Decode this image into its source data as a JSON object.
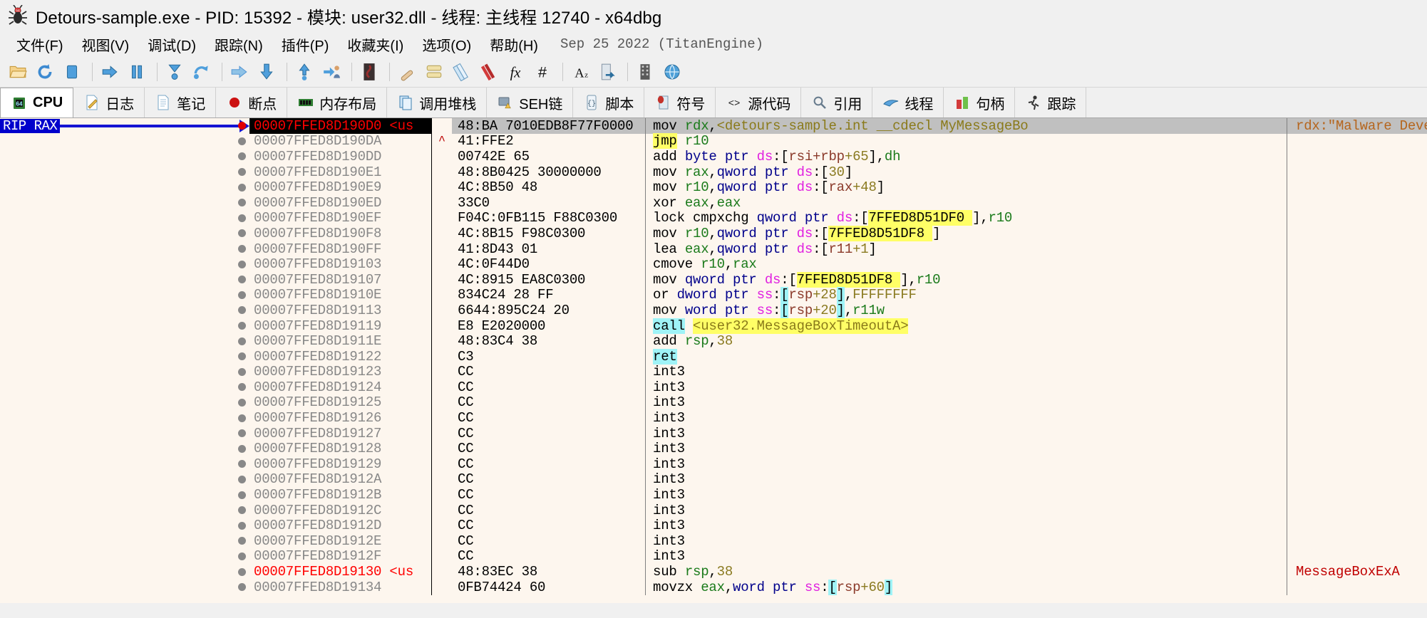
{
  "window": {
    "title": "Detours-sample.exe - PID: 15392 - 模块: user32.dll - 线程: 主线程 12740 - x64dbg",
    "icon": "bug-icon"
  },
  "menubar": {
    "items": [
      {
        "label": "文件(F)"
      },
      {
        "label": "视图(V)"
      },
      {
        "label": "调试(D)"
      },
      {
        "label": "跟踪(N)"
      },
      {
        "label": "插件(P)"
      },
      {
        "label": "收藏夹(I)"
      },
      {
        "label": "选项(O)"
      },
      {
        "label": "帮助(H)"
      }
    ],
    "version": "Sep 25 2022 (TitanEngine)"
  },
  "toolbar": {
    "buttons": [
      {
        "name": "open-icon",
        "title": "打开"
      },
      {
        "name": "restart-icon",
        "title": "重新运行"
      },
      {
        "name": "stop-icon",
        "title": "关闭"
      },
      {
        "sep": true
      },
      {
        "name": "run-icon",
        "title": "运行"
      },
      {
        "name": "pause-icon",
        "title": "暂停"
      },
      {
        "sep": true
      },
      {
        "name": "step-into-icon",
        "title": "单步进入"
      },
      {
        "name": "step-over-icon",
        "title": "单步步过"
      },
      {
        "sep": true
      },
      {
        "name": "trace-into-icon",
        "title": "跟踪进入"
      },
      {
        "name": "trace-over-icon",
        "title": "跟踪步过"
      },
      {
        "sep": true
      },
      {
        "name": "execute-till-return-icon",
        "title": "执行到返回"
      },
      {
        "name": "execute-till-user-code-icon",
        "title": "执行到用户代码"
      },
      {
        "sep": true
      },
      {
        "name": "scylla-icon",
        "title": "Scylla"
      },
      {
        "sep": true
      },
      {
        "name": "patch-icon",
        "title": "补丁"
      },
      {
        "name": "log-icon",
        "title": "日志"
      },
      {
        "name": "notes-icon",
        "title": "笔记"
      },
      {
        "name": "bookmark-icon",
        "title": "书签"
      },
      {
        "name": "function-icon",
        "title": "函数"
      },
      {
        "name": "hash-icon",
        "title": "计算器"
      },
      {
        "sep": true
      },
      {
        "name": "font-icon",
        "title": "字体"
      },
      {
        "name": "export-icon",
        "title": "导出"
      },
      {
        "sep": true
      },
      {
        "name": "memory-map-icon",
        "title": "内存布局"
      },
      {
        "name": "globe-icon",
        "title": "在线"
      }
    ]
  },
  "tabs": [
    {
      "label": "CPU",
      "icon": "cpu-chip-icon",
      "active": true
    },
    {
      "label": "日志",
      "icon": "log-page-icon",
      "active": false
    },
    {
      "label": "笔记",
      "icon": "notes-page-icon",
      "active": false
    },
    {
      "label": "断点",
      "icon": "breakpoint-dot-icon",
      "active": false
    },
    {
      "label": "内存布局",
      "icon": "memory-ram-icon",
      "active": false
    },
    {
      "label": "调用堆栈",
      "icon": "call-stack-icon",
      "active": false
    },
    {
      "label": "SEH链",
      "icon": "seh-warning-icon",
      "active": false
    },
    {
      "label": "脚本",
      "icon": "script-icon",
      "active": false
    },
    {
      "label": "符号",
      "icon": "symbol-book-icon",
      "active": false
    },
    {
      "label": "源代码",
      "icon": "source-code-icon",
      "active": false
    },
    {
      "label": "引用",
      "icon": "magnifier-icon",
      "active": false
    },
    {
      "label": "线程",
      "icon": "threads-icon",
      "active": false
    },
    {
      "label": "句柄",
      "icon": "handles-icon",
      "active": false
    },
    {
      "label": "跟踪",
      "icon": "trace-run-icon",
      "active": false
    }
  ],
  "disassembly": {
    "rip_label": "RIP RAX",
    "rows": [
      {
        "bp": "red",
        "addr": "00007FFED8D190D0",
        "addr_suffix": " <us",
        "arrow": "",
        "bytes": "48:BA 7010EDB8F77F0000",
        "dis_html": "<span class=\"mn\">mov</span> <span class=\"reg\">rdx</span>,<span class=\"sym\">&lt;detours-sample.int __cdecl MyMessageBo</span>",
        "dis_text": "mov rdx,<detours-sample.int __cdecl MyMessageBo",
        "comment": "rdx:\"Malware Development",
        "selected": true
      },
      {
        "bp": "gray",
        "addr": "00007FFED8D190DA",
        "addr_suffix": "",
        "arrow": "^",
        "bytes": "41:FFE2",
        "dis_html": "<span class=\"mn hl-y\">jmp</span> <span class=\"reg\">r10</span>",
        "dis_text": "jmp r10",
        "comment": ""
      },
      {
        "bp": "gray",
        "addr": "00007FFED8D190DD",
        "addr_suffix": "",
        "arrow": "",
        "bytes": "00742E 65",
        "dis_html": "<span class=\"mn\">add</span> <span class=\"kw\">byte ptr</span> <span class=\"seg\">ds</span>:<span class=\"brk\">[</span><span class=\"memreg\">rsi+rbp</span><span class=\"num\">+65</span><span class=\"brk\">]</span>,<span class=\"reg\">dh</span>",
        "dis_text": "add byte ptr ds:[rsi+rbp+65],dh",
        "comment": ""
      },
      {
        "bp": "gray",
        "addr": "00007FFED8D190E1",
        "addr_suffix": "",
        "arrow": "",
        "bytes": "48:8B0425 30000000",
        "dis_html": "<span class=\"mn\">mov</span> <span class=\"reg\">rax</span>,<span class=\"kw\">qword ptr</span> <span class=\"seg\">ds</span>:<span class=\"brk\">[</span><span class=\"num\">30</span><span class=\"brk\">]</span>",
        "dis_text": "mov rax,qword ptr ds:[30]",
        "comment": ""
      },
      {
        "bp": "gray",
        "addr": "00007FFED8D190E9",
        "addr_suffix": "",
        "arrow": "",
        "bytes": "4C:8B50 48",
        "dis_html": "<span class=\"mn\">mov</span> <span class=\"reg\">r10</span>,<span class=\"kw\">qword ptr</span> <span class=\"seg\">ds</span>:<span class=\"brk\">[</span><span class=\"memreg\">rax</span><span class=\"num\">+48</span><span class=\"brk\">]</span>",
        "dis_text": "mov r10,qword ptr ds:[rax+48]",
        "comment": ""
      },
      {
        "bp": "gray",
        "addr": "00007FFED8D190ED",
        "addr_suffix": "",
        "arrow": "",
        "bytes": "33C0",
        "dis_html": "<span class=\"mn\">xor</span> <span class=\"reg\">eax</span>,<span class=\"reg\">eax</span>",
        "dis_text": "xor eax,eax",
        "comment": ""
      },
      {
        "bp": "gray",
        "addr": "00007FFED8D190EF",
        "addr_suffix": "",
        "arrow": "",
        "bytes": "F04C:0FB115 F88C0300",
        "dis_html": "<span class=\"mn\">lock cmpxchg</span> <span class=\"kw\">qword ptr</span> <span class=\"seg\">ds</span>:<span class=\"brk\">[</span><span class=\"hl-y\">7FFED8D51DF0 </span><span class=\"brk\">]</span>,<span class=\"reg\">r10</span>",
        "dis_text": "lock cmpxchg qword ptr ds:[7FFED8D51DF0 ],r10",
        "comment": ""
      },
      {
        "bp": "gray",
        "addr": "00007FFED8D190F8",
        "addr_suffix": "",
        "arrow": "",
        "bytes": "4C:8B15 F98C0300",
        "dis_html": "<span class=\"mn\">mov</span> <span class=\"reg\">r10</span>,<span class=\"kw\">qword ptr</span> <span class=\"seg\">ds</span>:<span class=\"brk\">[</span><span class=\"hl-y\">7FFED8D51DF8 </span><span class=\"brk\">]</span>",
        "dis_text": "mov r10,qword ptr ds:[7FFED8D51DF8 ]",
        "comment": ""
      },
      {
        "bp": "gray",
        "addr": "00007FFED8D190FF",
        "addr_suffix": "",
        "arrow": "",
        "bytes": "41:8D43 01",
        "dis_html": "<span class=\"mn\">lea</span> <span class=\"reg\">eax</span>,<span class=\"kw\">qword ptr</span> <span class=\"seg\">ds</span>:<span class=\"brk\">[</span><span class=\"memreg\">r11</span><span class=\"num\">+1</span><span class=\"brk\">]</span>",
        "dis_text": "lea eax,qword ptr ds:[r11+1]",
        "comment": ""
      },
      {
        "bp": "gray",
        "addr": "00007FFED8D19103",
        "addr_suffix": "",
        "arrow": "",
        "bytes": "4C:0F44D0",
        "dis_html": "<span class=\"mn\">cmove</span> <span class=\"reg\">r10</span>,<span class=\"reg\">rax</span>",
        "dis_text": "cmove r10,rax",
        "comment": ""
      },
      {
        "bp": "gray",
        "addr": "00007FFED8D19107",
        "addr_suffix": "",
        "arrow": "",
        "bytes": "4C:8915 EA8C0300",
        "dis_html": "<span class=\"mn\">mov</span> <span class=\"kw\">qword ptr</span> <span class=\"seg\">ds</span>:<span class=\"brk\">[</span><span class=\"hl-y\">7FFED8D51DF8 </span><span class=\"brk\">]</span>,<span class=\"reg\">r10</span>",
        "dis_text": "mov qword ptr ds:[7FFED8D51DF8 ],r10",
        "comment": ""
      },
      {
        "bp": "gray",
        "addr": "00007FFED8D1910E",
        "addr_suffix": "",
        "arrow": "",
        "bytes": "834C24 28 FF",
        "dis_html": "<span class=\"mn\">or</span> <span class=\"kw\">dword ptr</span> <span class=\"seg\">ss</span>:<span class=\"hl-c brk\">[</span><span class=\"memreg\">rsp</span><span class=\"num\">+28</span><span class=\"hl-c brk\">]</span>,<span class=\"num\">FFFFFFFF</span>",
        "dis_text": "or dword ptr ss:[rsp+28],FFFFFFFF",
        "comment": ""
      },
      {
        "bp": "gray",
        "addr": "00007FFED8D19113",
        "addr_suffix": "",
        "arrow": "",
        "bytes": "6644:895C24 20",
        "dis_html": "<span class=\"mn\">mov</span> <span class=\"kw\">word ptr</span> <span class=\"seg\">ss</span>:<span class=\"hl-c brk\">[</span><span class=\"memreg\">rsp</span><span class=\"num\">+20</span><span class=\"hl-c brk\">]</span>,<span class=\"reg\">r11w</span>",
        "dis_text": "mov word ptr ss:[rsp+20],r11w",
        "comment": ""
      },
      {
        "bp": "gray",
        "addr": "00007FFED8D19119",
        "addr_suffix": "",
        "arrow": "",
        "bytes": "E8 E2020000",
        "dis_html": "<span class=\"mn hl-c\">call</span> <span class=\"hl-y sym\">&lt;user32.MessageBoxTimeoutA&gt;</span>",
        "dis_text": "call <user32.MessageBoxTimeoutA>",
        "comment": ""
      },
      {
        "bp": "gray",
        "addr": "00007FFED8D1911E",
        "addr_suffix": "",
        "arrow": "",
        "bytes": "48:83C4 38",
        "dis_html": "<span class=\"mn\">add</span> <span class=\"reg\">rsp</span>,<span class=\"num\">38</span>",
        "dis_text": "add rsp,38",
        "comment": ""
      },
      {
        "bp": "gray",
        "addr": "00007FFED8D19122",
        "addr_suffix": "",
        "arrow": "",
        "bytes": "C3",
        "dis_html": "<span class=\"mn hl-c\">ret</span>",
        "dis_text": "ret",
        "comment": ""
      },
      {
        "bp": "gray",
        "addr": "00007FFED8D19123",
        "addr_suffix": "",
        "arrow": "",
        "bytes": "CC",
        "dis_html": "<span class=\"mn\">int3</span>",
        "dis_text": "int3",
        "comment": ""
      },
      {
        "bp": "gray",
        "addr": "00007FFED8D19124",
        "addr_suffix": "",
        "arrow": "",
        "bytes": "CC",
        "dis_html": "<span class=\"mn\">int3</span>",
        "dis_text": "int3",
        "comment": ""
      },
      {
        "bp": "gray",
        "addr": "00007FFED8D19125",
        "addr_suffix": "",
        "arrow": "",
        "bytes": "CC",
        "dis_html": "<span class=\"mn\">int3</span>",
        "dis_text": "int3",
        "comment": ""
      },
      {
        "bp": "gray",
        "addr": "00007FFED8D19126",
        "addr_suffix": "",
        "arrow": "",
        "bytes": "CC",
        "dis_html": "<span class=\"mn\">int3</span>",
        "dis_text": "int3",
        "comment": ""
      },
      {
        "bp": "gray",
        "addr": "00007FFED8D19127",
        "addr_suffix": "",
        "arrow": "",
        "bytes": "CC",
        "dis_html": "<span class=\"mn\">int3</span>",
        "dis_text": "int3",
        "comment": ""
      },
      {
        "bp": "gray",
        "addr": "00007FFED8D19128",
        "addr_suffix": "",
        "arrow": "",
        "bytes": "CC",
        "dis_html": "<span class=\"mn\">int3</span>",
        "dis_text": "int3",
        "comment": ""
      },
      {
        "bp": "gray",
        "addr": "00007FFED8D19129",
        "addr_suffix": "",
        "arrow": "",
        "bytes": "CC",
        "dis_html": "<span class=\"mn\">int3</span>",
        "dis_text": "int3",
        "comment": ""
      },
      {
        "bp": "gray",
        "addr": "00007FFED8D1912A",
        "addr_suffix": "",
        "arrow": "",
        "bytes": "CC",
        "dis_html": "<span class=\"mn\">int3</span>",
        "dis_text": "int3",
        "comment": ""
      },
      {
        "bp": "gray",
        "addr": "00007FFED8D1912B",
        "addr_suffix": "",
        "arrow": "",
        "bytes": "CC",
        "dis_html": "<span class=\"mn\">int3</span>",
        "dis_text": "int3",
        "comment": ""
      },
      {
        "bp": "gray",
        "addr": "00007FFED8D1912C",
        "addr_suffix": "",
        "arrow": "",
        "bytes": "CC",
        "dis_html": "<span class=\"mn\">int3</span>",
        "dis_text": "int3",
        "comment": ""
      },
      {
        "bp": "gray",
        "addr": "00007FFED8D1912D",
        "addr_suffix": "",
        "arrow": "",
        "bytes": "CC",
        "dis_html": "<span class=\"mn\">int3</span>",
        "dis_text": "int3",
        "comment": ""
      },
      {
        "bp": "gray",
        "addr": "00007FFED8D1912E",
        "addr_suffix": "",
        "arrow": "",
        "bytes": "CC",
        "dis_html": "<span class=\"mn\">int3</span>",
        "dis_text": "int3",
        "comment": ""
      },
      {
        "bp": "gray",
        "addr": "00007FFED8D1912F",
        "addr_suffix": "",
        "arrow": "",
        "bytes": "CC",
        "dis_html": "<span class=\"mn\">int3</span>",
        "dis_text": "int3",
        "comment": ""
      },
      {
        "bp": "gray",
        "addr": "00007FFED8D19130",
        "addr_suffix": " <us",
        "arrow": "",
        "bytes": "48:83EC 38",
        "dis_html": "<span class=\"mn\">sub</span> <span class=\"reg\">rsp</span>,<span class=\"num\">38</span>",
        "dis_text": "sub rsp,38",
        "comment": "MessageBoxExA",
        "addr_red": true
      },
      {
        "bp": "gray",
        "addr": "00007FFED8D19134",
        "addr_suffix": "",
        "arrow": "",
        "bytes": "0FB74424 60",
        "dis_html": "<span class=\"mn\">movzx</span> <span class=\"reg\">eax</span>,<span class=\"kw\">word ptr</span> <span class=\"seg\">ss</span>:<span class=\"hl-c brk\">[</span><span class=\"memreg\">rsp</span><span class=\"num\">+60</span><span class=\"hl-c brk\">]</span>",
        "dis_text": "movzx eax,word ptr ss:[rsp+60]",
        "comment": ""
      }
    ]
  }
}
